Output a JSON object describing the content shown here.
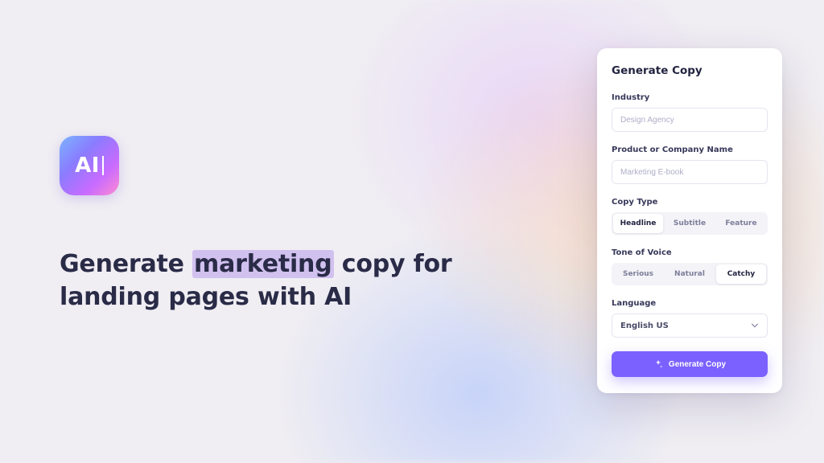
{
  "logo": {
    "text": "AI"
  },
  "hero": {
    "headline_pre": "Generate ",
    "headline_highlight": "marketing",
    "headline_post": " copy for landing pages with AI"
  },
  "panel": {
    "title": "Generate Copy",
    "industry_label": "Industry",
    "industry_placeholder": "Design Agency",
    "product_label": "Product or Company Name",
    "product_placeholder": "Marketing E-book",
    "copytype_label": "Copy Type",
    "copytype_options": [
      "Headline",
      "Subtitle",
      "Feature"
    ],
    "copytype_selected": "Headline",
    "tone_label": "Tone of Voice",
    "tone_options": [
      "Serious",
      "Natural",
      "Catchy"
    ],
    "tone_selected": "Catchy",
    "language_label": "Language",
    "language_value": "English US",
    "submit_label": "Generate Copy"
  }
}
